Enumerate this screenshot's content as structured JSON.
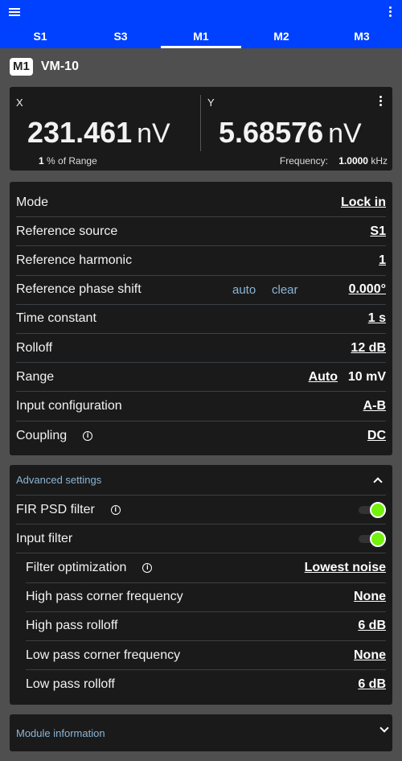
{
  "appbar": {
    "tabs": [
      {
        "label": "S1",
        "active": false
      },
      {
        "label": "S3",
        "active": false
      },
      {
        "label": "M1",
        "active": true
      },
      {
        "label": "M2",
        "active": false
      },
      {
        "label": "M3",
        "active": false
      }
    ],
    "icons": {
      "menu": "hamburger-icon",
      "more": "kebab-menu-icon"
    },
    "color": "#0041ff"
  },
  "module": {
    "badge": "M1",
    "name": "VM-10"
  },
  "measurement": {
    "x": {
      "label": "X",
      "value": "231.461",
      "unit": "nV",
      "range_value": "1",
      "range_label": "% of Range"
    },
    "y": {
      "label": "Y",
      "value": "5.68576",
      "unit": "nV",
      "frequency_label": "Frequency:",
      "frequency_value": "1.0000",
      "frequency_unit": "kHz"
    }
  },
  "settings": {
    "mode": {
      "label": "Mode",
      "value": "Lock in"
    },
    "reference_source": {
      "label": "Reference source",
      "value": "S1"
    },
    "reference_harmonic": {
      "label": "Reference harmonic",
      "value": "1"
    },
    "reference_phase_shift": {
      "label": "Reference phase shift",
      "auto": "auto",
      "clear": "clear",
      "value": "0.000°"
    },
    "time_constant": {
      "label": "Time constant",
      "value": "1 s"
    },
    "rolloff": {
      "label": "Rolloff",
      "value": "12 dB"
    },
    "range": {
      "label": "Range",
      "auto": "Auto",
      "value": "10 mV"
    },
    "input_configuration": {
      "label": "Input configuration",
      "value": "A-B"
    },
    "coupling": {
      "label": "Coupling",
      "info": "i",
      "value": "DC"
    }
  },
  "advanced": {
    "title": "Advanced settings",
    "expanded": true,
    "fir_psd_filter": {
      "label": "FIR PSD filter",
      "info": "i",
      "enabled": true
    },
    "input_filter": {
      "label": "Input filter",
      "enabled": true
    },
    "filter_optimization": {
      "label": "Filter optimization",
      "info": "i",
      "value": "Lowest noise"
    },
    "high_pass_corner": {
      "label": "High pass corner frequency",
      "value": "None"
    },
    "high_pass_rolloff": {
      "label": "High pass rolloff",
      "value": "6 dB"
    },
    "low_pass_corner": {
      "label": "Low pass corner frequency",
      "value": "None"
    },
    "low_pass_rolloff": {
      "label": "Low pass rolloff",
      "value": "6 dB"
    },
    "toggle_color": "#73f20d"
  },
  "module_info": {
    "title": "Module information",
    "expanded": false
  }
}
